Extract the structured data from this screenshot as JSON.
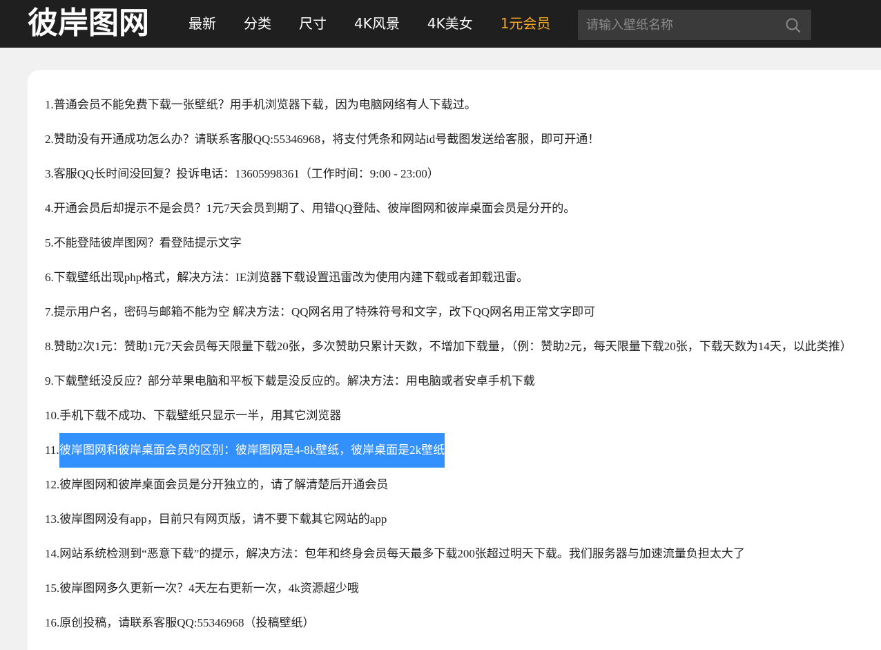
{
  "header": {
    "logo": "彼岸图网",
    "nav": [
      {
        "label": "最新"
      },
      {
        "label": "分类"
      },
      {
        "label": "尺寸"
      },
      {
        "label": "4K风景"
      },
      {
        "label": "4K美女"
      },
      {
        "label": "1元会员"
      }
    ],
    "search_placeholder": "请输入壁纸名称",
    "accent_color": "#f5a623"
  },
  "faq": [
    "1.普通会员不能免费下载一张壁纸？用手机浏览器下载，因为电脑网络有人下载过。",
    "2.赞助没有开通成功怎么办？请联系客服QQ:55346968，将支付凭条和网站id号截图发送给客服，即可开通！",
    "3.客服QQ长时间没回复？投诉电话：13605998361（工作时间：9:00 - 23:00）",
    "4.开通会员后却提示不是会员？1元7天会员到期了、用错QQ登陆、彼岸图网和彼岸桌面会员是分开的。",
    "5.不能登陆彼岸图网？看登陆提示文字",
    "6.下载壁纸出现php格式，解决方法：IE浏览器下载设置迅雷改为使用内建下载或者卸载迅雷。",
    "7.提示用户名，密码与邮箱不能为空 解决方法：QQ网名用了特殊符号和文字，改下QQ网名用正常文字即可",
    "8.赞助2次1元：赞助1元7天会员每天限量下载20张，多次赞助只累计天数，不增加下载量，（例：赞助2元，每天限量下载20张，下载天数为14天，以此类推）",
    "9.下载壁纸没反应？部分苹果电脑和平板下载是没反应的。解决方法：用电脑或者安卓手机下载",
    "10.手机下载不成功、下载壁纸只显示一半，用其它浏览器",
    "11.",
    "12.彼岸图网和彼岸桌面会员是分开独立的，请了解清楚后开通会员",
    "13.彼岸图网没有app，目前只有网页版，请不要下载其它网站的app",
    "14.网站系统检测到“恶意下载”的提示，解决方法：包年和终身会员每天最多下载200张超过明天下载。我们服务器与加速流量负担太大了",
    "15.彼岸图网多久更新一次？4天左右更新一次，4k资源超少哦",
    "16.原创投稿，请联系客服QQ:55346968（投稿壁纸）"
  ],
  "faq_highlight": "彼岸图网和彼岸桌面会员的区别：彼岸图网是4-8k壁纸，彼岸桌面是2k壁纸",
  "selection_color": "#3390ff"
}
